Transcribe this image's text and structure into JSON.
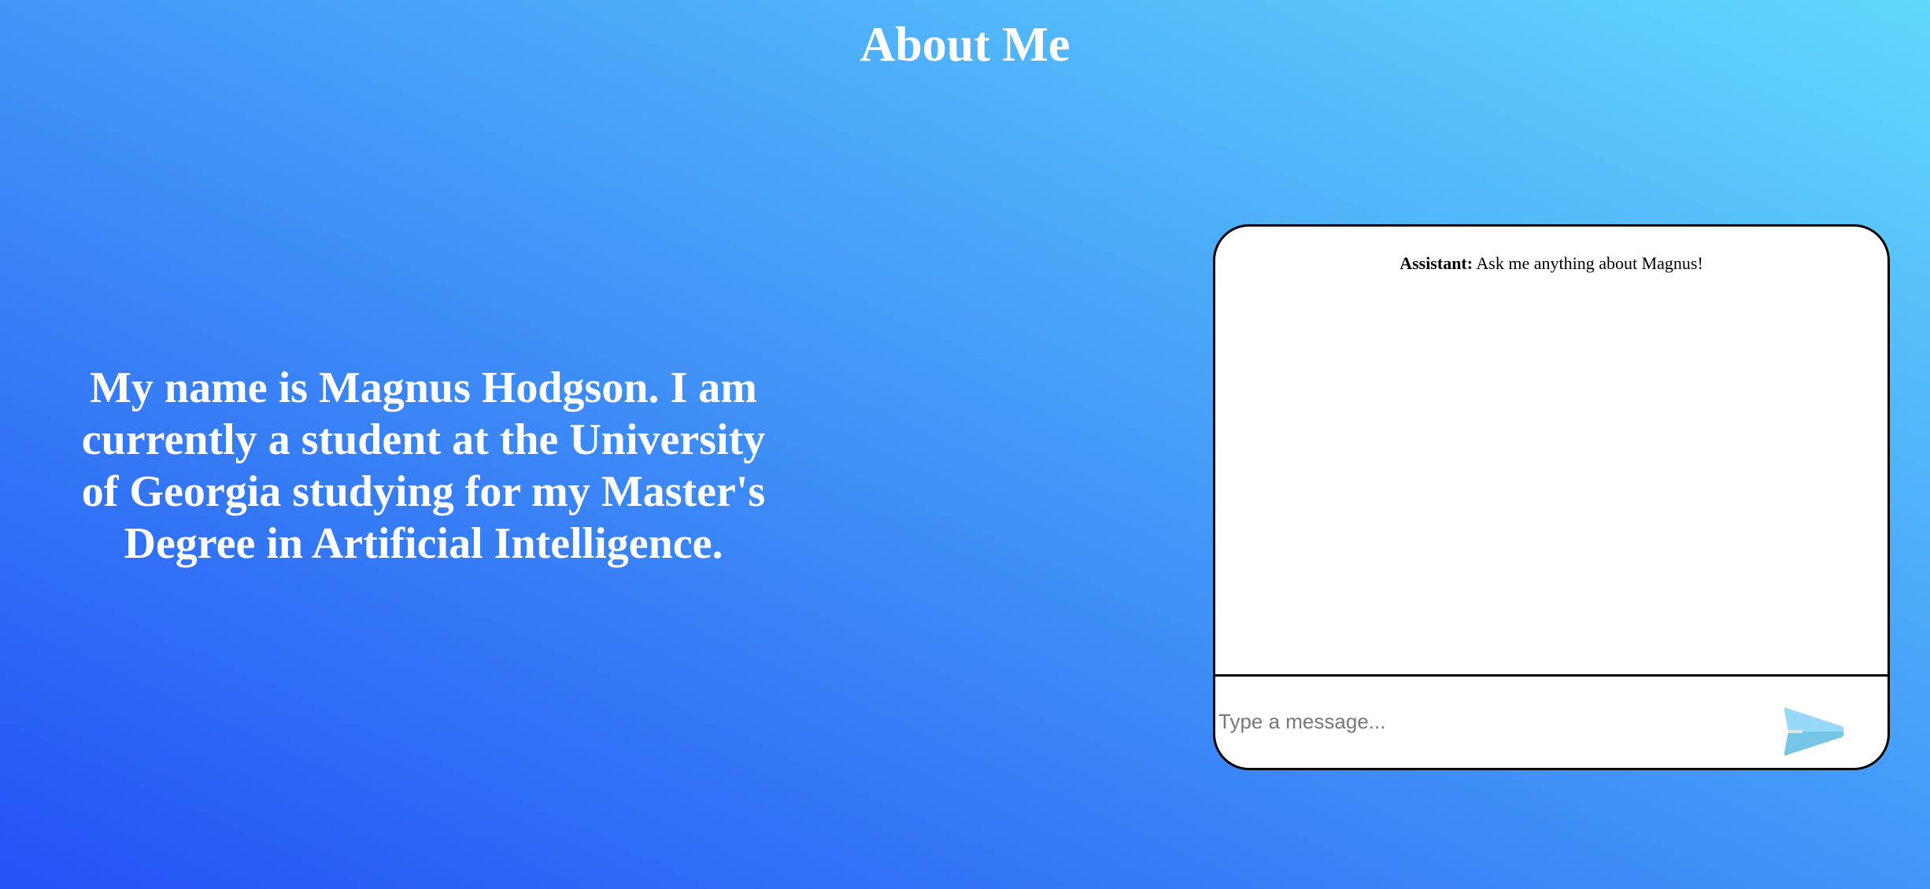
{
  "header": {
    "title": "About Me"
  },
  "intro": {
    "text": "My name is Magnus Hodgson. I am currently a student at the University of Georgia studying for my Master's Degree in Artificial Intelligence."
  },
  "chat": {
    "messages": [
      {
        "sender": "Assistant:",
        "text": "Ask me anything about Magnus!"
      }
    ],
    "input": {
      "value": "",
      "placeholder": "Type a message..."
    },
    "send_icon": "paper-plane-send-icon",
    "send_color": "#7fd0f0"
  }
}
